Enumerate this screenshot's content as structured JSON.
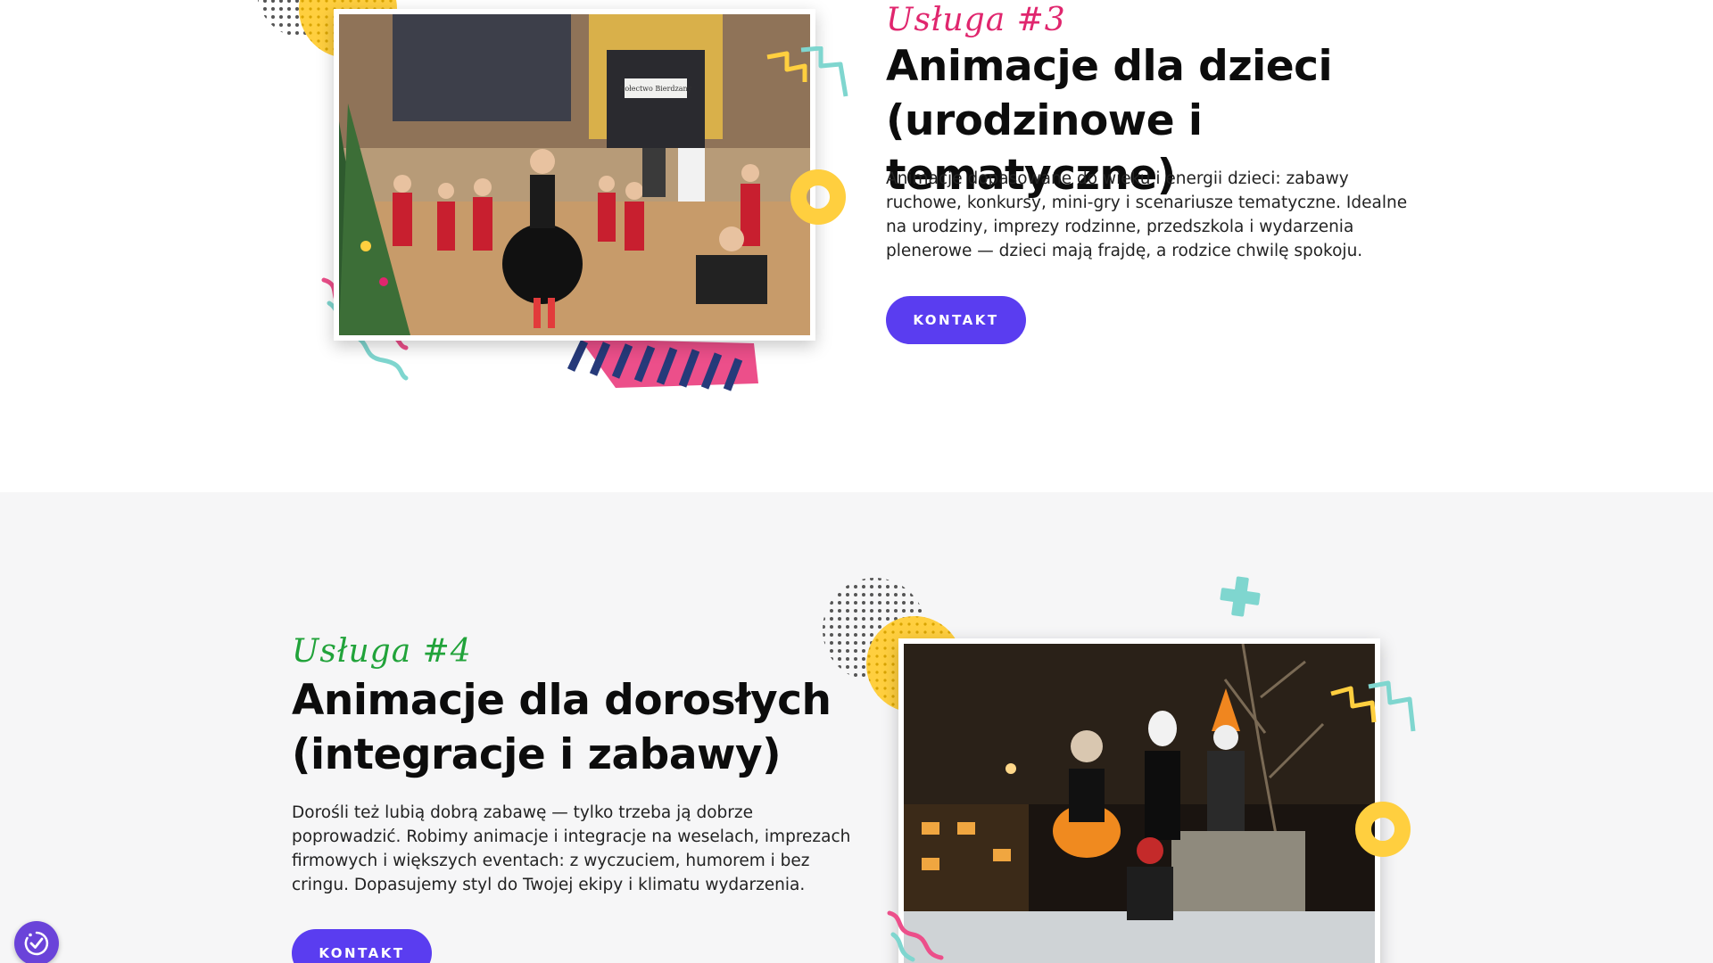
{
  "service3": {
    "eyebrow": "Usługa #3",
    "title_line1": "Animacje dla dzieci",
    "title_line2": "(urodzinowe i tematyczne)",
    "description": "Animacje dopasowane do wieku i energii dzieci: zabawy ruchowe, konkursy, mini-gry i scenariusze tematyczne. Idealne na urodziny, imprezy rodzinne, przedszkola i wydarzenia plenerowe — dzieci mają frajdę, a rodzice chwilę spokoju.",
    "button_label": "KONTAKT",
    "photo_sign": "Sołectwo Bierdzany"
  },
  "service4": {
    "eyebrow": "Usługa #4",
    "title_line1": "Animacje dla dorosłych",
    "title_line2": "(integracje i zabawy)",
    "description": "Dorośli też lubią dobrą zabawę — tylko trzeba ją dobrze poprowadzić. Robimy animacje i integracje na weselach, imprezach firmowych i większych eventach: z wyczuciem, humorem i bez cringu. Dopasujemy styl do Twojej ekipy i klimatu wydarzenia.",
    "button_label": "KONTAKT"
  },
  "colors": {
    "button": "#5a3df0",
    "eyebrow3": "#e0266e",
    "eyebrow4": "#21a33a",
    "yellow": "#ffcf3f",
    "teal": "#7fd6cf",
    "pink": "#ec4f8a",
    "navy": "#263a7a"
  },
  "accessibility": {
    "icon": "accessibility-check-icon"
  }
}
